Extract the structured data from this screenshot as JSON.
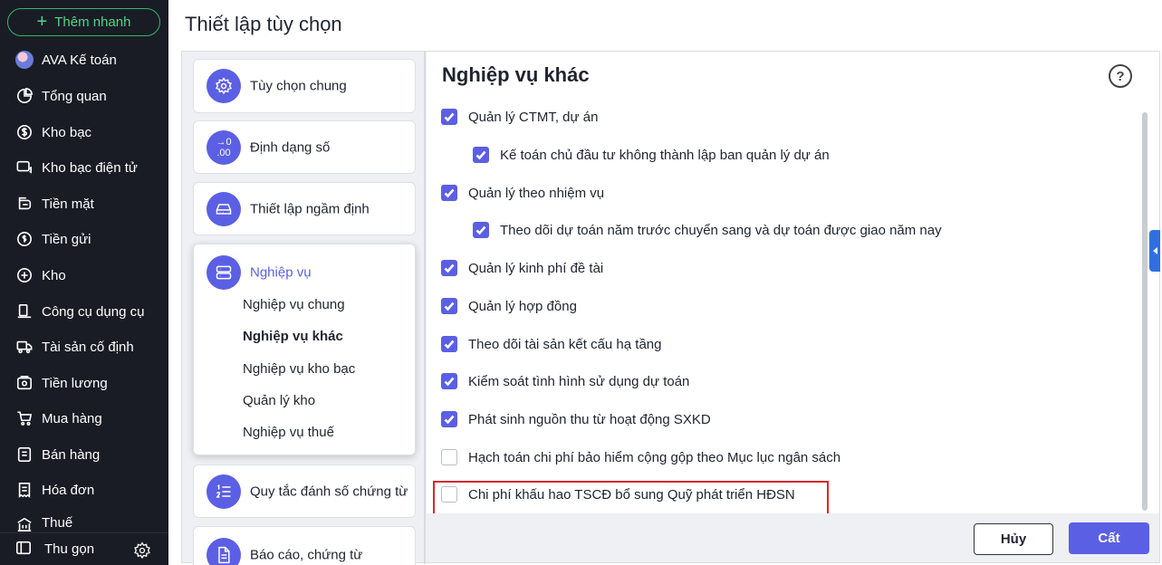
{
  "sidebar": {
    "quick_add": "Thêm nhanh",
    "items": [
      {
        "label": "AVA Kế toán",
        "icon": "avatar"
      },
      {
        "label": "Tổng quan",
        "icon": "chart-pie-icon"
      },
      {
        "label": "Kho bạc",
        "icon": "dollar-icon"
      },
      {
        "label": "Kho bạc điện tử",
        "icon": "card-dollar-icon"
      },
      {
        "label": "Tiền mặt",
        "icon": "cash-icon"
      },
      {
        "label": "Tiền gửi",
        "icon": "deposit-icon"
      },
      {
        "label": "Kho",
        "icon": "warehouse-icon"
      },
      {
        "label": "Công cụ dụng cụ",
        "icon": "tools-icon"
      },
      {
        "label": "Tài sản cố định",
        "icon": "truck-icon"
      },
      {
        "label": "Tiền lương",
        "icon": "payroll-icon"
      },
      {
        "label": "Mua hàng",
        "icon": "cart-icon"
      },
      {
        "label": "Bán hàng",
        "icon": "store-icon"
      },
      {
        "label": "Hóa đơn",
        "icon": "invoice-icon"
      },
      {
        "label": "Thuế",
        "icon": "tax-icon"
      }
    ],
    "collapse": "Thu gọn"
  },
  "page": {
    "title": "Thiết lập tùy chọn"
  },
  "settings_menu": {
    "items": [
      {
        "label": "Tùy chọn chung",
        "icon": "gear-icon"
      },
      {
        "label": "Định dạng số",
        "icon": "number-format-icon",
        "glyph": "→0\n.00"
      },
      {
        "label": "Thiết lập ngầm định",
        "icon": "drive-icon"
      },
      {
        "label": "Nghiệp vụ",
        "icon": "server-icon"
      },
      {
        "label": "Quy tắc đánh số chứng từ",
        "icon": "numbered-list-icon"
      },
      {
        "label": "Báo cáo, chứng từ",
        "icon": "document-icon"
      }
    ],
    "sub_items": [
      "Nghiệp vụ chung",
      "Nghiệp vụ khác",
      "Nghiệp vụ kho bạc",
      "Quản lý kho",
      "Nghiệp vụ thuế"
    ]
  },
  "content": {
    "title": "Nghiệp vụ khác",
    "help": "?",
    "options": [
      {
        "label": "Quản lý CTMT, dự án",
        "checked": true
      },
      {
        "label": "Kế toán chủ đầu tư không thành lập ban quản lý dự án",
        "checked": true
      },
      {
        "label": "Quản lý theo nhiệm vụ",
        "checked": true
      },
      {
        "label": "Theo dõi dự toán năm trước chuyển sang và dự toán được giao năm nay",
        "checked": true
      },
      {
        "label": "Quản lý kinh phí đề tài",
        "checked": true
      },
      {
        "label": "Quản lý hợp đồng",
        "checked": true
      },
      {
        "label": "Theo dõi tài sản kết cấu hạ tầng",
        "checked": true
      },
      {
        "label": "Kiểm soát tình hình sử dụng dự toán",
        "checked": true
      },
      {
        "label": "Phát sinh nguồn thu từ hoạt động SXKD",
        "checked": true
      },
      {
        "label": "Hạch toán chi phí bảo hiểm cộng gộp theo Mục lục ngân sách",
        "checked": false
      },
      {
        "label": "Chi phí khấu hao TSCĐ bổ sung Quỹ phát triển HĐSN",
        "checked": false
      }
    ]
  },
  "actions": {
    "cancel": "Hủy",
    "save": "Cất"
  },
  "colors": {
    "sidebar_bg": "#191c24",
    "accent": "#5b5fe3",
    "quick_add": "#2fb86a",
    "highlight": "#d9262c"
  }
}
